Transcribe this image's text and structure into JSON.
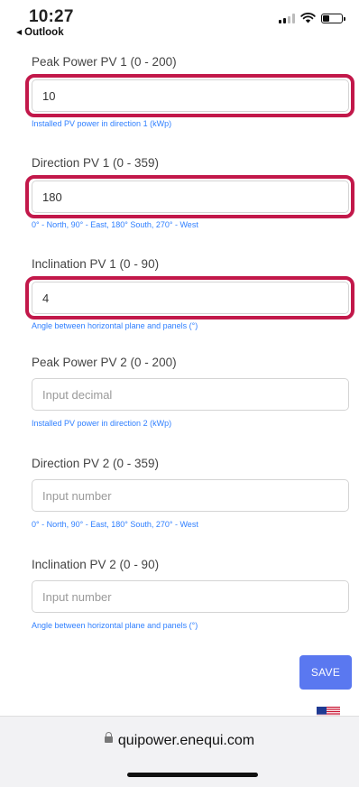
{
  "status": {
    "time": "10:27",
    "back_app": "Outlook"
  },
  "fields": [
    {
      "label": "Peak Power PV 1 (0 - 200)",
      "value": "10",
      "placeholder": "",
      "help": "Installed PV power in direction 1 (kWp)",
      "highlighted": true
    },
    {
      "label": "Direction PV 1 (0 - 359)",
      "value": "180",
      "placeholder": "",
      "help": "0° - North, 90° - East, 180° South, 270° - West",
      "highlighted": true
    },
    {
      "label": "Inclination PV 1 (0 - 90)",
      "value": "4",
      "placeholder": "",
      "help": "Angle between horizontal plane and panels (°)",
      "highlighted": true
    },
    {
      "label": "Peak Power PV 2 (0 - 200)",
      "value": "",
      "placeholder": "Input decimal",
      "help": "Installed PV power in direction 2 (kWp)",
      "highlighted": false
    },
    {
      "label": "Direction PV 2 (0 - 359)",
      "value": "",
      "placeholder": "Input number",
      "help": "0° - North, 90° - East, 180° South, 270° - West",
      "highlighted": false
    },
    {
      "label": "Inclination PV 2 (0 - 90)",
      "value": "",
      "placeholder": "Input number",
      "help": "Angle between horizontal plane and panels (°)",
      "highlighted": false
    }
  ],
  "actions": {
    "save_label": "SAVE"
  },
  "browser": {
    "url": "quipower.enequi.com"
  },
  "colors": {
    "accent": "#5a78f0",
    "highlight": "#c2184a",
    "help_text": "#2f7fff"
  },
  "icons": {
    "language_flag": "us-flag-icon",
    "lock": "lock-icon"
  }
}
